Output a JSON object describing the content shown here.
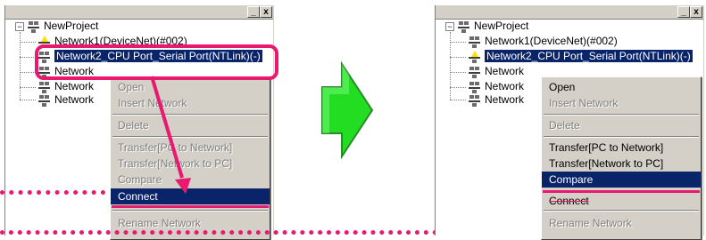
{
  "colors": {
    "accent": "#e8196e",
    "selection": "#0a246a",
    "arrow": "#22dd22"
  },
  "window": {
    "min_glyph": "_",
    "close_glyph": "x"
  },
  "left": {
    "tree": {
      "root": "NewProject",
      "items": [
        "Network1(DeviceNet)(#002)",
        "Network2_CPU Port_Serial Port(NTLink)(-)",
        "Network",
        "Network",
        "Network"
      ]
    },
    "menu": [
      {
        "label": "Open",
        "state": "disabled"
      },
      {
        "label": "Insert Network",
        "state": "disabled"
      },
      {
        "label": "Delete",
        "state": "disabled"
      },
      {
        "label": "Transfer[PC to Network]",
        "state": "disabled"
      },
      {
        "label": "Transfer[Network to PC]",
        "state": "disabled"
      },
      {
        "label": "Compare",
        "state": "disabled"
      },
      {
        "label": "Connect",
        "state": "highlight"
      },
      {
        "label": "Rename Network",
        "state": "disabled"
      }
    ]
  },
  "right": {
    "tree": {
      "root": "NewProject",
      "items": [
        "Network1(DeviceNet)(#002)",
        "Network2_CPU Port_Serial Port(NTLink)(-)",
        "Network",
        "Network",
        "Network"
      ]
    },
    "menu": [
      {
        "label": "Open",
        "state": "normal"
      },
      {
        "label": "Insert Network",
        "state": "disabled"
      },
      {
        "label": "Delete",
        "state": "disabled"
      },
      {
        "label": "Transfer[PC to Network]",
        "state": "normal"
      },
      {
        "label": "Transfer[Network to PC]",
        "state": "normal"
      },
      {
        "label": "Compare",
        "state": "highlight"
      },
      {
        "label": "Connect",
        "state": "normal"
      },
      {
        "label": "Rename Network",
        "state": "disabled"
      }
    ]
  }
}
